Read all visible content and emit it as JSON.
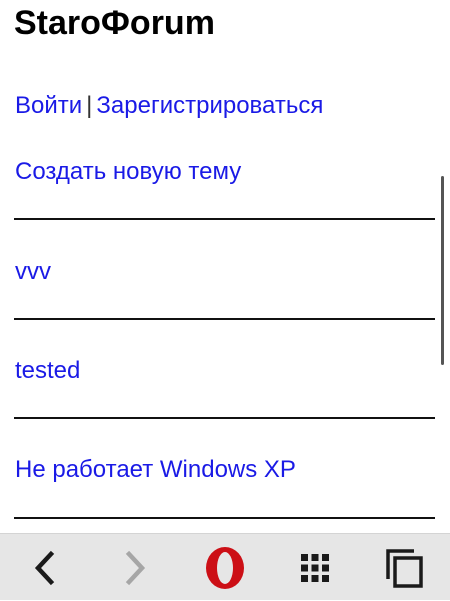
{
  "site": {
    "title": "StaroФorum"
  },
  "auth": {
    "login_label": "Войти",
    "separator": "|",
    "register_label": "Зарегистрироваться"
  },
  "new_topic_label": "Создать новую тему",
  "topics": [
    {
      "title": "vvv"
    },
    {
      "title": "tested"
    },
    {
      "title": "Не работает Windows XP"
    }
  ],
  "browser_nav": {
    "back_icon": "chevron-left-icon",
    "forward_icon": "chevron-right-icon",
    "opera_icon": "opera-logo-icon",
    "speed_dial_icon": "grid-icon",
    "tabs_icon": "tabs-icon"
  },
  "colors": {
    "link": "#1a1ae6",
    "text": "#000000",
    "nav_background": "#e6e6e6",
    "opera_red": "#cc0f16"
  }
}
